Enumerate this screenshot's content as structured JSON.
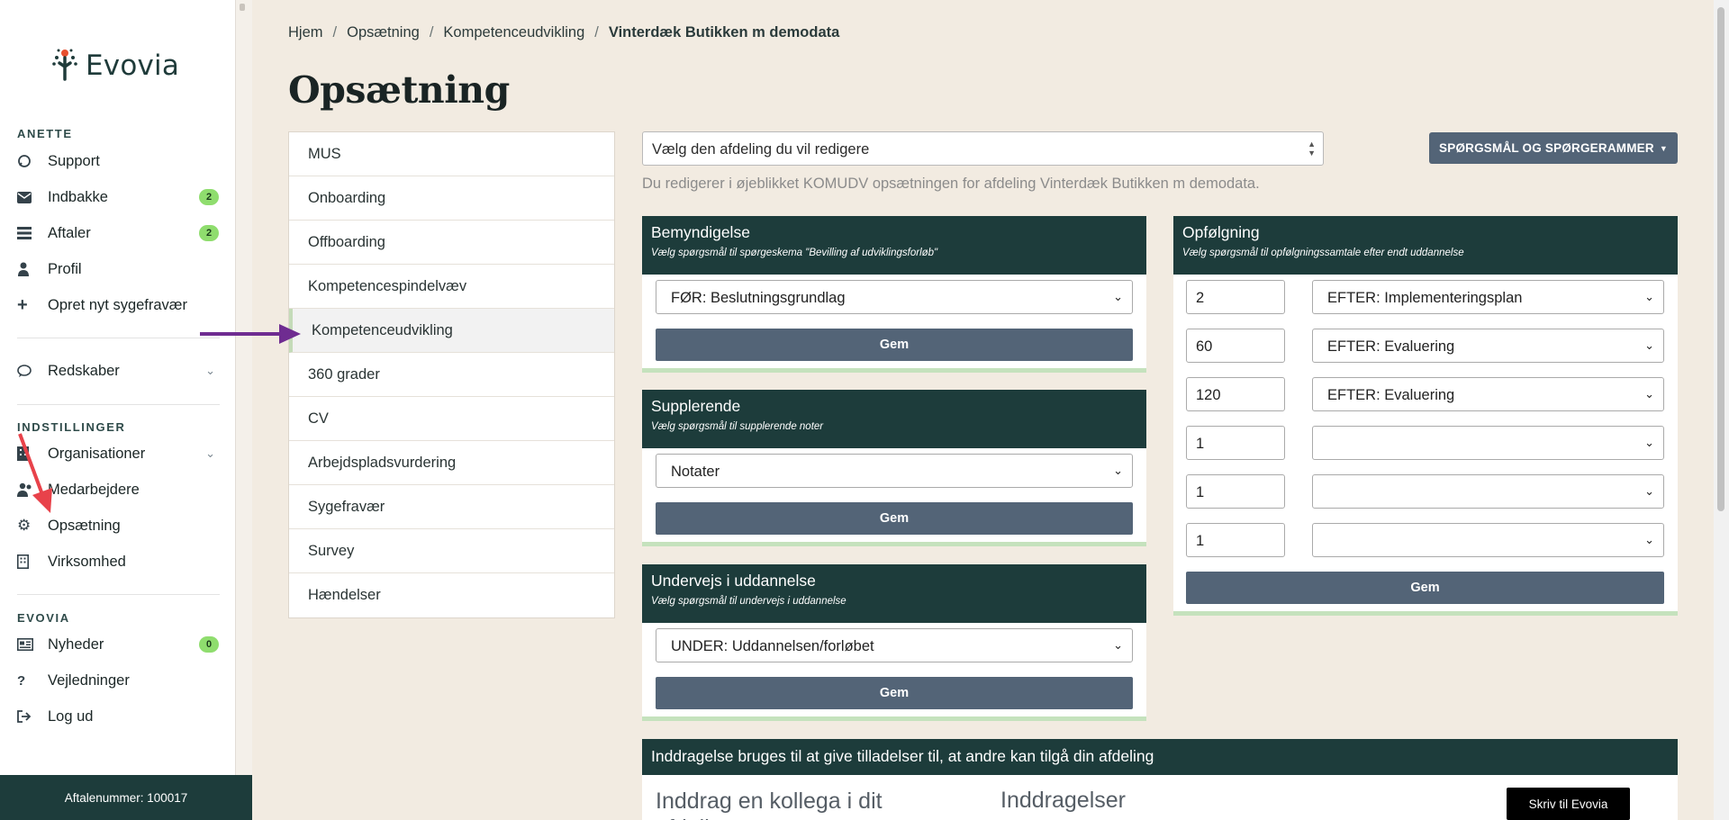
{
  "app": {
    "brand": "Evovia"
  },
  "sidebar": {
    "section_user": "ANETTE",
    "items_user": [
      {
        "label": "Support",
        "icon": "support-icon"
      },
      {
        "label": "Indbakke",
        "icon": "envelope-icon",
        "badge": "2"
      },
      {
        "label": "Aftaler",
        "icon": "list-icon",
        "badge": "2"
      },
      {
        "label": "Profil",
        "icon": "user-icon"
      },
      {
        "label": "Opret nyt sygefravær",
        "icon": "plus-icon"
      }
    ],
    "tools": {
      "label": "Redskaber",
      "icon": "chat-icon"
    },
    "section_settings": "INDSTILLINGER",
    "items_settings": [
      {
        "label": "Organisationer",
        "icon": "building-icon"
      },
      {
        "label": "Medarbejdere",
        "icon": "users-icon"
      },
      {
        "label": "Opsætning",
        "icon": "gear-icon"
      },
      {
        "label": "Virksomhed",
        "icon": "office-icon"
      }
    ],
    "section_evovia": "EVOVIA",
    "items_evovia": [
      {
        "label": "Nyheder",
        "icon": "newspaper-icon",
        "badge": "0"
      },
      {
        "label": "Vejledninger",
        "icon": "question-icon"
      },
      {
        "label": "Log ud",
        "icon": "logout-icon"
      }
    ],
    "footer": "Aftalenummer: 100017"
  },
  "breadcrumb": [
    "Hjem",
    "Opsætning",
    "Kompetenceudvikling",
    "Vinterdæk Butikken m demodata"
  ],
  "page_title": "Opsætning",
  "tabs": [
    "MUS",
    "Onboarding",
    "Offboarding",
    "Kompetencespindelvæv",
    "Kompetenceudvikling",
    "360 grader",
    "CV",
    "Arbejdspladsvurdering",
    "Sygefravær",
    "Survey",
    "Hændelser"
  ],
  "active_tab": "Kompetenceudvikling",
  "department_select": {
    "value": "Vælg den afdeling du vil redigere"
  },
  "info_text": "Du redigerer i øjeblikket KOMUDV opsætningen for afdeling Vinterdæk Butikken m demodata.",
  "questions_button": "SPØRGSMÅL OG SPØRGERAMMER",
  "panels": {
    "bemyndigelse": {
      "title": "Bemyndigelse",
      "subtitle": "Vælg spørgsmål til spørgeskema \"Bevilling af udviklingsforløb\"",
      "select": "FØR: Beslutningsgrundlag",
      "save": "Gem"
    },
    "supplerende": {
      "title": "Supplerende",
      "subtitle": "Vælg spørgsmål til supplerende noter",
      "select": "Notater",
      "save": "Gem"
    },
    "undervejs": {
      "title": "Undervejs i uddannelse",
      "subtitle": "Vælg spørgsmål til undervejs i uddannelse",
      "select": "UNDER: Uddannelsen/forløbet",
      "save": "Gem"
    },
    "opfolgning": {
      "title": "Opfølgning",
      "subtitle": "Vælg spørgsmål til opfølgningssamtale efter endt uddannelse",
      "rows": [
        {
          "days": "2",
          "select": "EFTER: Implementeringsplan"
        },
        {
          "days": "60",
          "select": "EFTER: Evaluering"
        },
        {
          "days": "120",
          "select": "EFTER: Evaluering"
        },
        {
          "days": "1",
          "select": ""
        },
        {
          "days": "1",
          "select": ""
        },
        {
          "days": "1",
          "select": ""
        }
      ],
      "save": "Gem"
    }
  },
  "inddragelse": {
    "header": "Inddragelse bruges til at give tilladelser til, at andre kan tilgå din afdeling",
    "left_title": "Inddrag en kollega i dit afdelingsansvar",
    "right_title": "Inddragelser",
    "write_button": "Skriv til Evovia"
  },
  "colors": {
    "dark_green": "#1d3c3b",
    "slate_button": "#536477",
    "badge_green": "#8fdd6e",
    "background": "#f2ebe1"
  }
}
